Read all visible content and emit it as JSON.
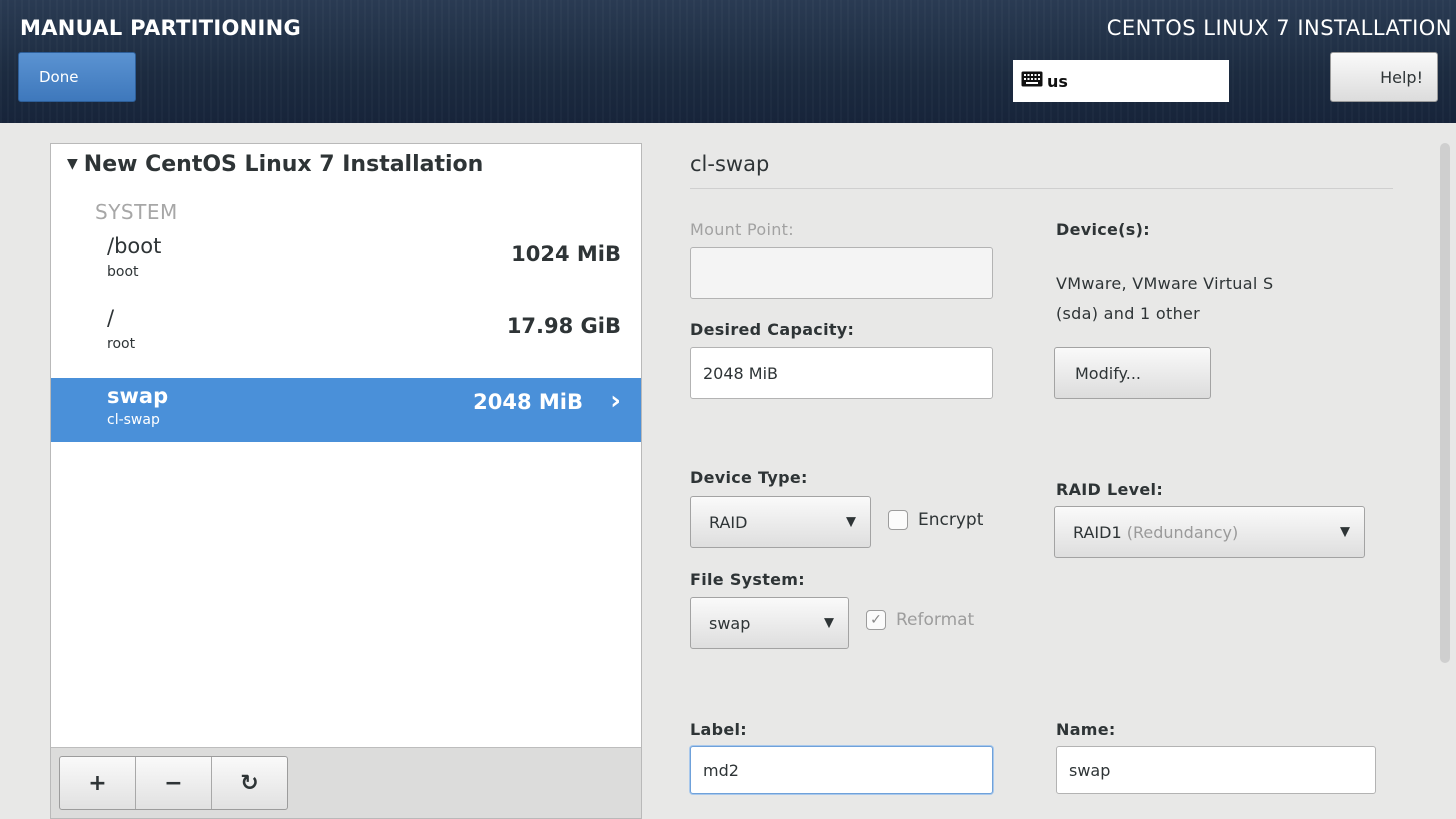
{
  "header": {
    "title": "MANUAL PARTITIONING",
    "product": "CENTOS LINUX 7 INSTALLATION",
    "done_label": "Done",
    "keyboard_layout": "us",
    "help_label": "Help!"
  },
  "tree": {
    "root_label": "New CentOS Linux 7 Installation",
    "section": "SYSTEM",
    "items": [
      {
        "mount": "/boot",
        "sub": "boot",
        "size": "1024 MiB"
      },
      {
        "mount": "/",
        "sub": "root",
        "size": "17.98 GiB"
      },
      {
        "mount": "swap",
        "sub": "cl-swap",
        "size": "2048 MiB",
        "selected": true
      }
    ]
  },
  "toolbar": {
    "add": "+",
    "remove": "−",
    "refresh": "↻"
  },
  "detail": {
    "title": "cl-swap",
    "mount_point_label": "Mount Point:",
    "mount_point_value": "",
    "desired_capacity_label": "Desired Capacity:",
    "desired_capacity_value": "2048 MiB",
    "devices_label": "Device(s):",
    "devices_line1": "VMware, VMware Virtual S",
    "devices_line2": "(sda) and 1 other",
    "modify_label": "Modify...",
    "device_type_label": "Device Type:",
    "device_type_value": "RAID",
    "encrypt_label": "Encrypt",
    "raid_level_label": "RAID Level:",
    "raid_level_value": "RAID1",
    "raid_level_hint": "(Redundancy)",
    "file_system_label": "File System:",
    "file_system_value": "swap",
    "reformat_label": "Reformat",
    "label_label": "Label:",
    "label_value": "md2",
    "name_label": "Name:",
    "name_value": "swap"
  },
  "colors": {
    "header_bg": "#1c2b40",
    "accent": "#4a90d9",
    "done_button": "#3e78bc"
  },
  "icons": {
    "tree_toggle": "triangle-down-icon",
    "keyboard": "keyboard-icon",
    "chevron": "chevron-right-icon"
  }
}
